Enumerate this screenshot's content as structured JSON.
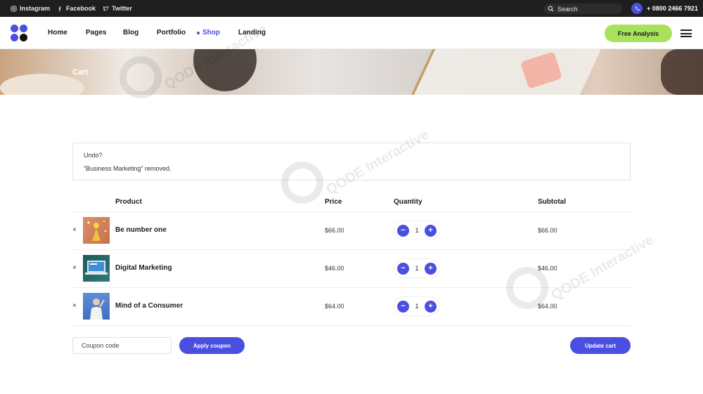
{
  "topbar": {
    "social": [
      {
        "label": "Instagram",
        "icon": "instagram-icon"
      },
      {
        "label": "Facebook",
        "icon": "facebook-icon"
      },
      {
        "label": "Twitter",
        "icon": "twitter-icon"
      }
    ],
    "search_label": "Search",
    "phone": "+ 0800 2466 7921"
  },
  "header": {
    "nav": [
      "Home",
      "Pages",
      "Blog",
      "Portfolio",
      "Shop",
      "Landing"
    ],
    "active_nav": "Shop",
    "cta": "Free Analysis"
  },
  "hero": {
    "title": "Cart"
  },
  "notice": {
    "undo": "Undo?",
    "message": "“Business Marketing” removed."
  },
  "table": {
    "headers": {
      "product": "Product",
      "price": "Price",
      "quantity": "Quantity",
      "subtotal": "Subtotal"
    },
    "rows": [
      {
        "remove": "×",
        "name": "Be number one",
        "price": "$66.00",
        "qty": "1",
        "subtotal": "$66.00",
        "thumb": "orange-figure"
      },
      {
        "remove": "×",
        "name": "Digital Marketing",
        "price": "$46.00",
        "qty": "1",
        "subtotal": "$46.00",
        "thumb": "laptop-screen"
      },
      {
        "remove": "×",
        "name": "Mind of a Consumer",
        "price": "$64.00",
        "qty": "1",
        "subtotal": "$64.00",
        "thumb": "blue-person"
      }
    ],
    "minus": "−",
    "plus": "+"
  },
  "actions": {
    "coupon_placeholder": "Coupon code",
    "apply": "Apply coupon",
    "update": "Update cart"
  },
  "colors": {
    "accent": "#4b4fe0",
    "cta": "#a8e25c",
    "topbar": "#1e1e1e"
  },
  "watermark": "QODE Interactive"
}
